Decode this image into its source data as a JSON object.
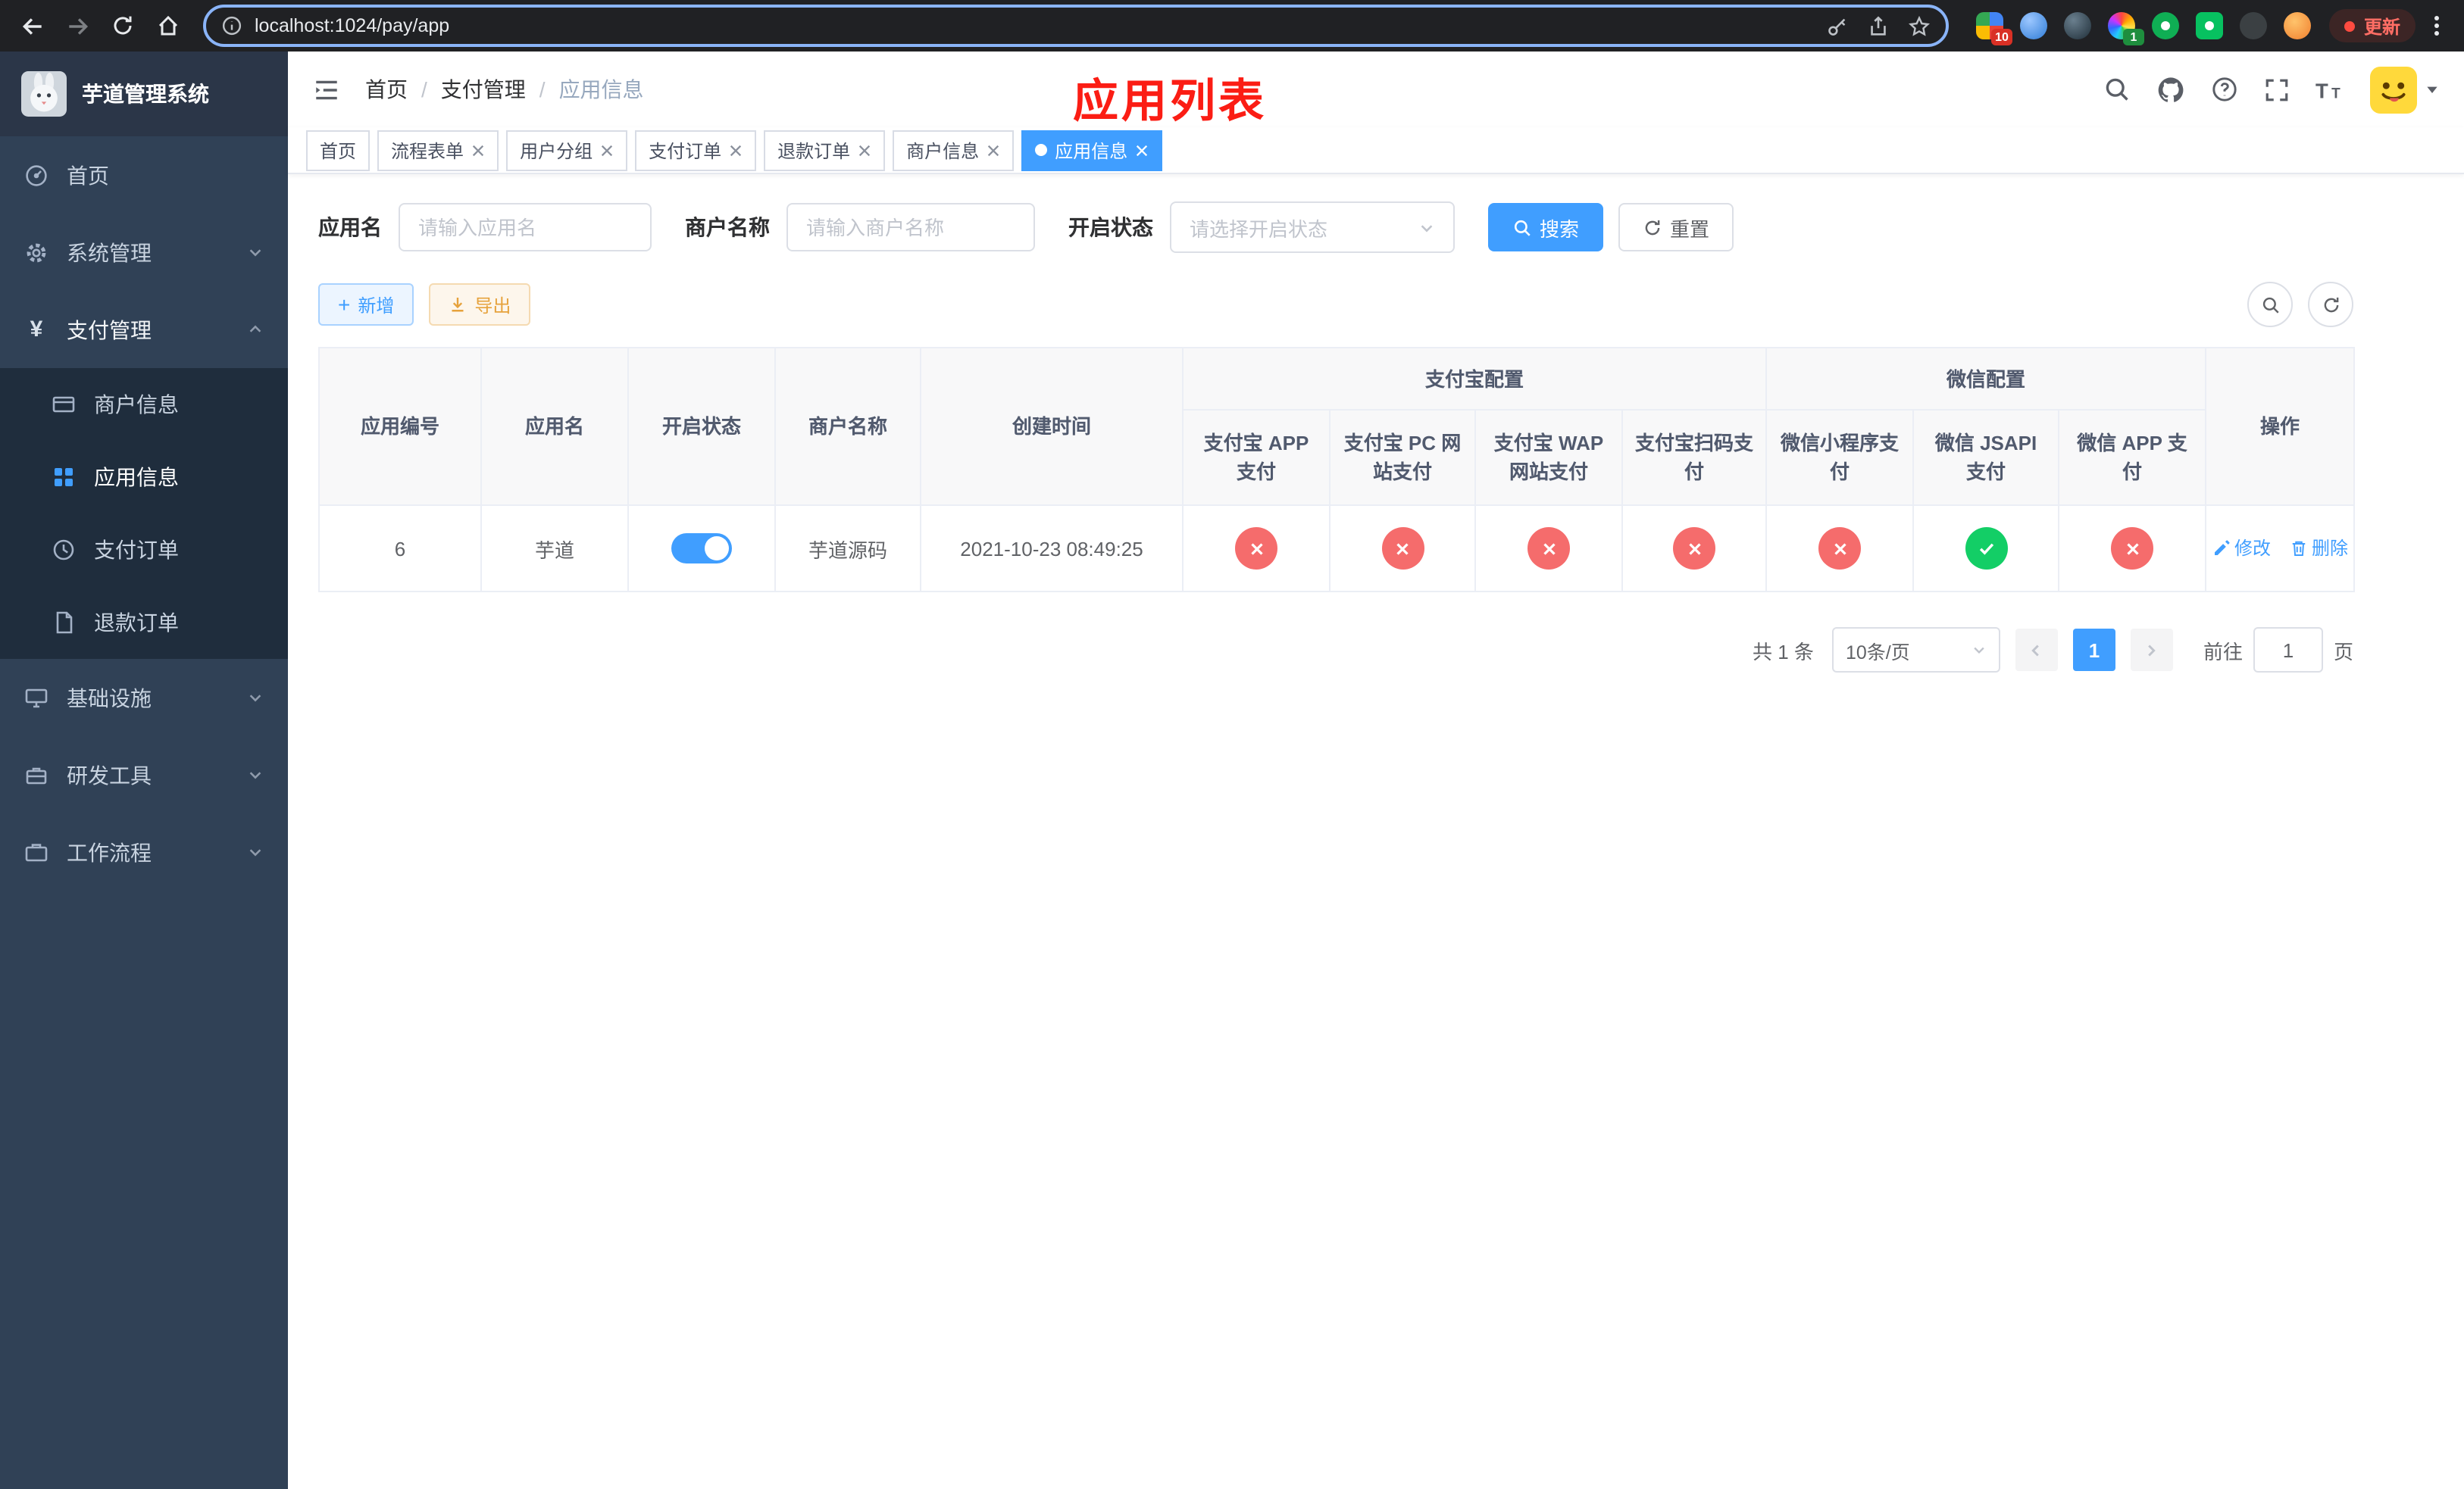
{
  "browser": {
    "url": "localhost:1024/pay/app",
    "update_button": "更新",
    "ext_badge_a": "10",
    "ext_badge_b": "1"
  },
  "sidebar": {
    "app_title": "芋道管理系统",
    "menu": [
      {
        "label": "首页"
      },
      {
        "label": "系统管理"
      },
      {
        "label": "支付管理"
      },
      {
        "label": "基础设施"
      },
      {
        "label": "研发工具"
      },
      {
        "label": "工作流程"
      }
    ],
    "submenu": [
      {
        "label": "商户信息"
      },
      {
        "label": "应用信息"
      },
      {
        "label": "支付订单"
      },
      {
        "label": "退款订单"
      }
    ]
  },
  "header": {
    "breadcrumb": [
      "首页",
      "支付管理",
      "应用信息"
    ],
    "separator": "/",
    "annotation": "应用列表"
  },
  "tabs": [
    {
      "label": "首页"
    },
    {
      "label": "流程表单"
    },
    {
      "label": "用户分组"
    },
    {
      "label": "支付订单"
    },
    {
      "label": "退款订单"
    },
    {
      "label": "商户信息"
    },
    {
      "label": "应用信息"
    }
  ],
  "filters": {
    "app_name_label": "应用名",
    "app_name_placeholder": "请输入应用名",
    "merchant_label": "商户名称",
    "merchant_placeholder": "请输入商户名称",
    "status_label": "开启状态",
    "status_placeholder": "请选择开启状态",
    "search_button": "搜索",
    "reset_button": "重置"
  },
  "toolbar": {
    "add_button": "新增",
    "export_button": "导出"
  },
  "table": {
    "columns": {
      "app_id": "应用编号",
      "app_name": "应用名",
      "status": "开启状态",
      "merchant": "商户名称",
      "created": "创建时间",
      "alipay_group": "支付宝配置",
      "wechat_group": "微信配置",
      "actions": "操作",
      "alipay_app": "支付宝 APP 支付",
      "alipay_pc": "支付宝 PC 网站支付",
      "alipay_wap": "支付宝 WAP 网站支付",
      "alipay_qr": "支付宝扫码支付",
      "wx_mini": "微信小程序支付",
      "wx_jsapi": "微信 JSAPI 支付",
      "wx_app": "微信 APP 支付"
    },
    "rows": [
      {
        "app_id": "6",
        "app_name": "芋道",
        "status_on": true,
        "merchant": "芋道源码",
        "created": "2021-10-23 08:49:25",
        "alipay_app": false,
        "alipay_pc": false,
        "alipay_wap": false,
        "alipay_qr": false,
        "wx_mini": false,
        "wx_jsapi": true,
        "wx_app": false,
        "edit": "修改",
        "delete": "删除"
      }
    ]
  },
  "pagination": {
    "total": "共 1 条",
    "page_size": "10条/页",
    "current_page": "1",
    "goto_prefix": "前往",
    "goto_value": "1",
    "goto_suffix": "页"
  },
  "colors": {
    "primary": "#409eff",
    "success": "#13ce66",
    "danger": "#f56c6c",
    "warning": "#e6a23c",
    "sidebar_bg": "#304156",
    "submenu_bg": "#1f2d3d",
    "annotation_red": "#fb1d14"
  }
}
